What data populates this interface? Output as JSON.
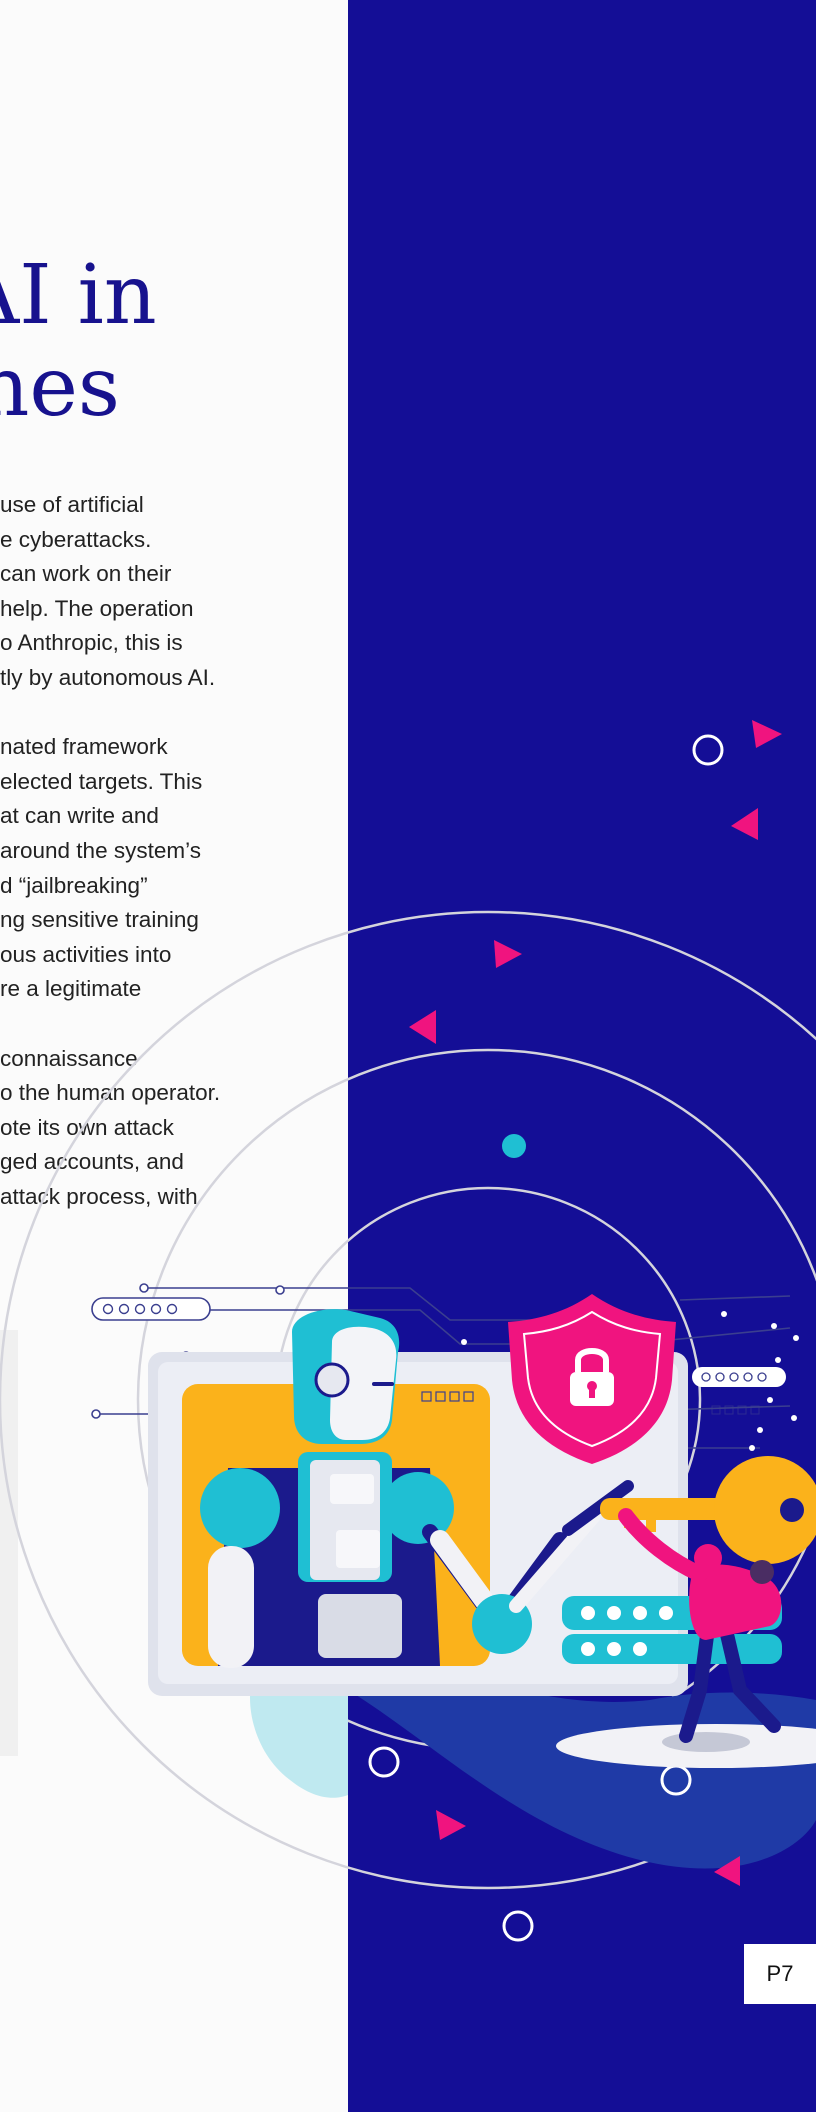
{
  "heading": {
    "line1": "AI in",
    "line2": "hes"
  },
  "body": {
    "paragraphs": [
      [
        "use of artificial",
        "e cyberattacks.",
        "can work on their",
        "help. The operation",
        "o Anthropic, this is",
        "tly by autonomous AI."
      ],
      [
        "nated framework",
        "elected targets. This",
        "at can write and",
        "around the system’s",
        "d “jailbreaking”",
        "ng sensitive training",
        "ous activities into",
        "re a legitimate"
      ],
      [
        "connaissance",
        "o the human operator.",
        "ote its own attack",
        "ged accounts, and",
        "attack process, with"
      ]
    ]
  },
  "page_number": "P7",
  "colors": {
    "navy": "#140e96",
    "heading": "#17128e",
    "pink": "#f0147f",
    "yellow": "#fbb21b",
    "teal": "#1fbfd3"
  }
}
